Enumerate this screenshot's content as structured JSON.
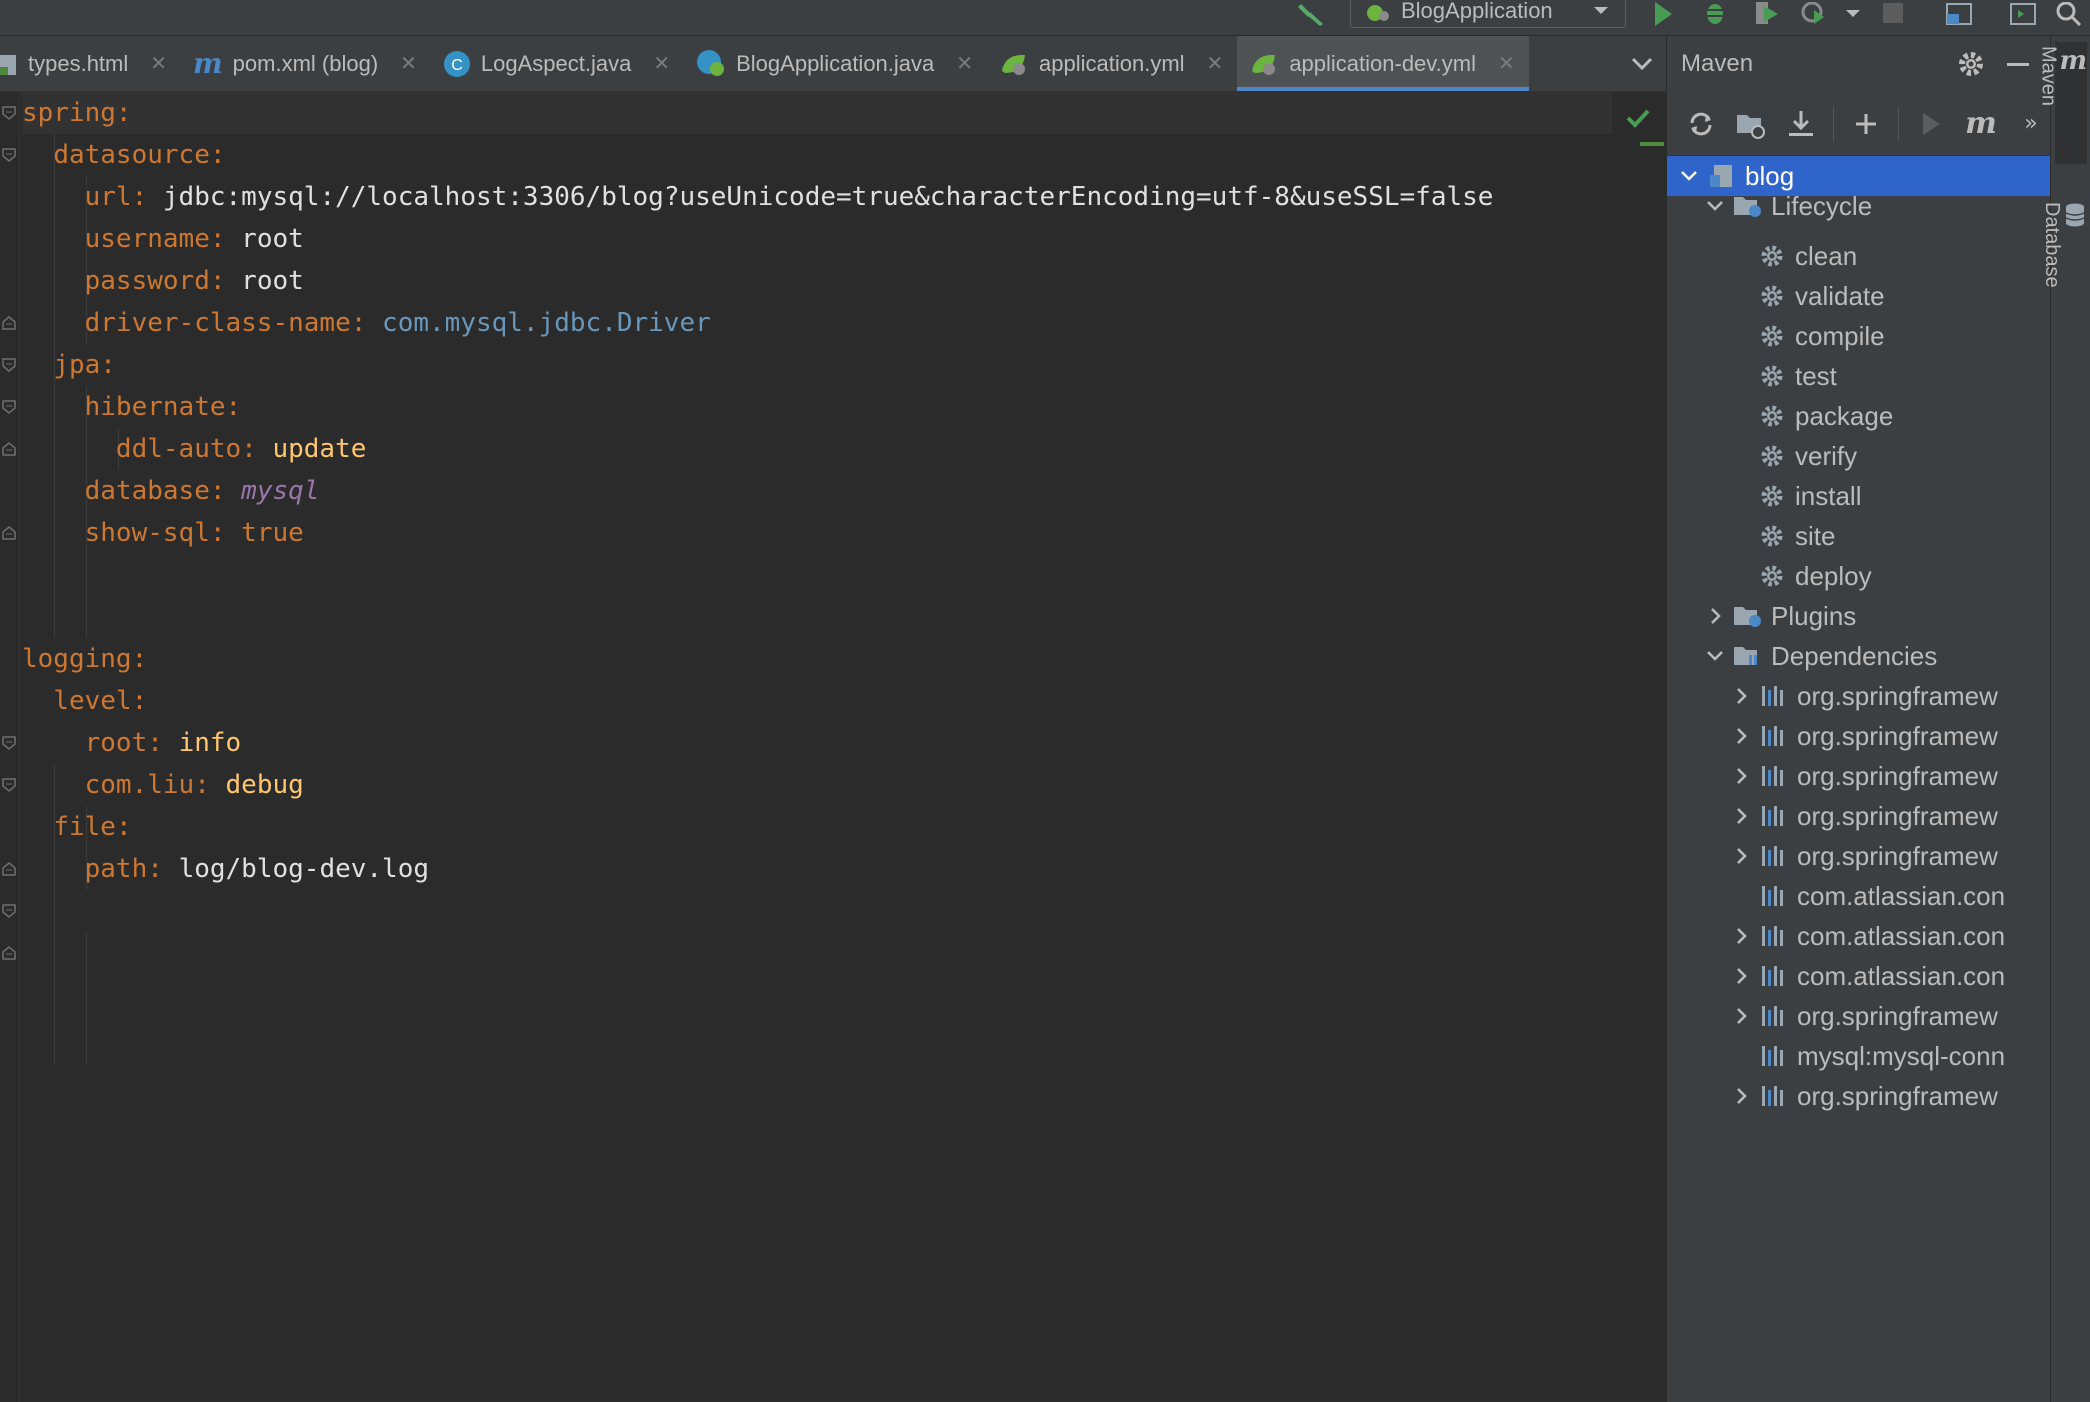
{
  "toolbar": {
    "run_config": "BlogApplication",
    "icons": [
      "hammer-icon",
      "run-icon",
      "debug-icon",
      "coverage-icon",
      "profile-icon",
      "stop-icon",
      "project-structure-icon",
      "terminal-icon",
      "search-icon"
    ]
  },
  "tabs": [
    {
      "label": "types.html",
      "icon": "html-file-icon"
    },
    {
      "label": "pom.xml (blog)",
      "icon": "maven-file-icon"
    },
    {
      "label": "LogAspect.java",
      "icon": "java-class-icon"
    },
    {
      "label": "BlogApplication.java",
      "icon": "spring-boot-class-icon"
    },
    {
      "label": "application.yml",
      "icon": "spring-config-icon"
    },
    {
      "label": "application-dev.yml",
      "icon": "spring-config-icon",
      "active": true
    }
  ],
  "editor": {
    "lines": {
      "l1": {
        "key": "spring",
        "colon": ":"
      },
      "l2": {
        "key": "datasource",
        "colon": ":"
      },
      "l3": {
        "key": "url",
        "colon": ": ",
        "value": "jdbc:mysql://localhost:3306/blog?useUnicode=true&characterEncoding=utf-8&useSSL=false"
      },
      "l4": {
        "key": "username",
        "colon": ": ",
        "value": "root"
      },
      "l5": {
        "key": "password",
        "colon": ": ",
        "value": "root"
      },
      "l6": {
        "key": "driver-class-name",
        "colon": ": ",
        "value": "com.mysql.jdbc.Driver"
      },
      "l7": {
        "key": "jpa",
        "colon": ":"
      },
      "l8": {
        "key": "hibernate",
        "colon": ":"
      },
      "l9": {
        "key": "ddl-auto",
        "colon": ": ",
        "value": "update"
      },
      "l10": {
        "key": "database",
        "colon": ": ",
        "value": "mysql"
      },
      "l11": {
        "key": "show-sql",
        "colon": ": ",
        "value": "true"
      },
      "l14": {
        "key": "logging",
        "colon": ":"
      },
      "l15": {
        "key": "level",
        "colon": ":"
      },
      "l16": {
        "key": "root",
        "colon": ": ",
        "value": "info"
      },
      "l17": {
        "key": "com.liu",
        "colon": ": ",
        "value": "debug"
      },
      "l18": {
        "key": "file",
        "colon": ":"
      },
      "l19": {
        "key": "path",
        "colon": ": ",
        "value": "log/blog-dev.log"
      }
    }
  },
  "maven": {
    "title": "Maven",
    "tree": {
      "root": "blog",
      "lifecycle": "Lifecycle",
      "phases": [
        "clean",
        "validate",
        "compile",
        "test",
        "package",
        "verify",
        "install",
        "site",
        "deploy"
      ],
      "plugins": "Plugins",
      "dependencies_label": "Dependencies",
      "dependencies": [
        "org.springframew",
        "org.springframew",
        "org.springframew",
        "org.springframew",
        "org.springframew",
        "com.atlassian.con",
        "com.atlassian.con",
        "com.atlassian.con",
        "org.springframew",
        "mysql:mysql-conn",
        "org.springframew"
      ]
    }
  },
  "stripe": {
    "maven": "Maven",
    "database": "Database"
  },
  "colors": {
    "background": "#2b2b2b",
    "panel": "#3c3f41",
    "selection": "#2f65ca",
    "key": "#cc7832",
    "string": "#a9b7c6",
    "class_ref": "#6897bb"
  }
}
